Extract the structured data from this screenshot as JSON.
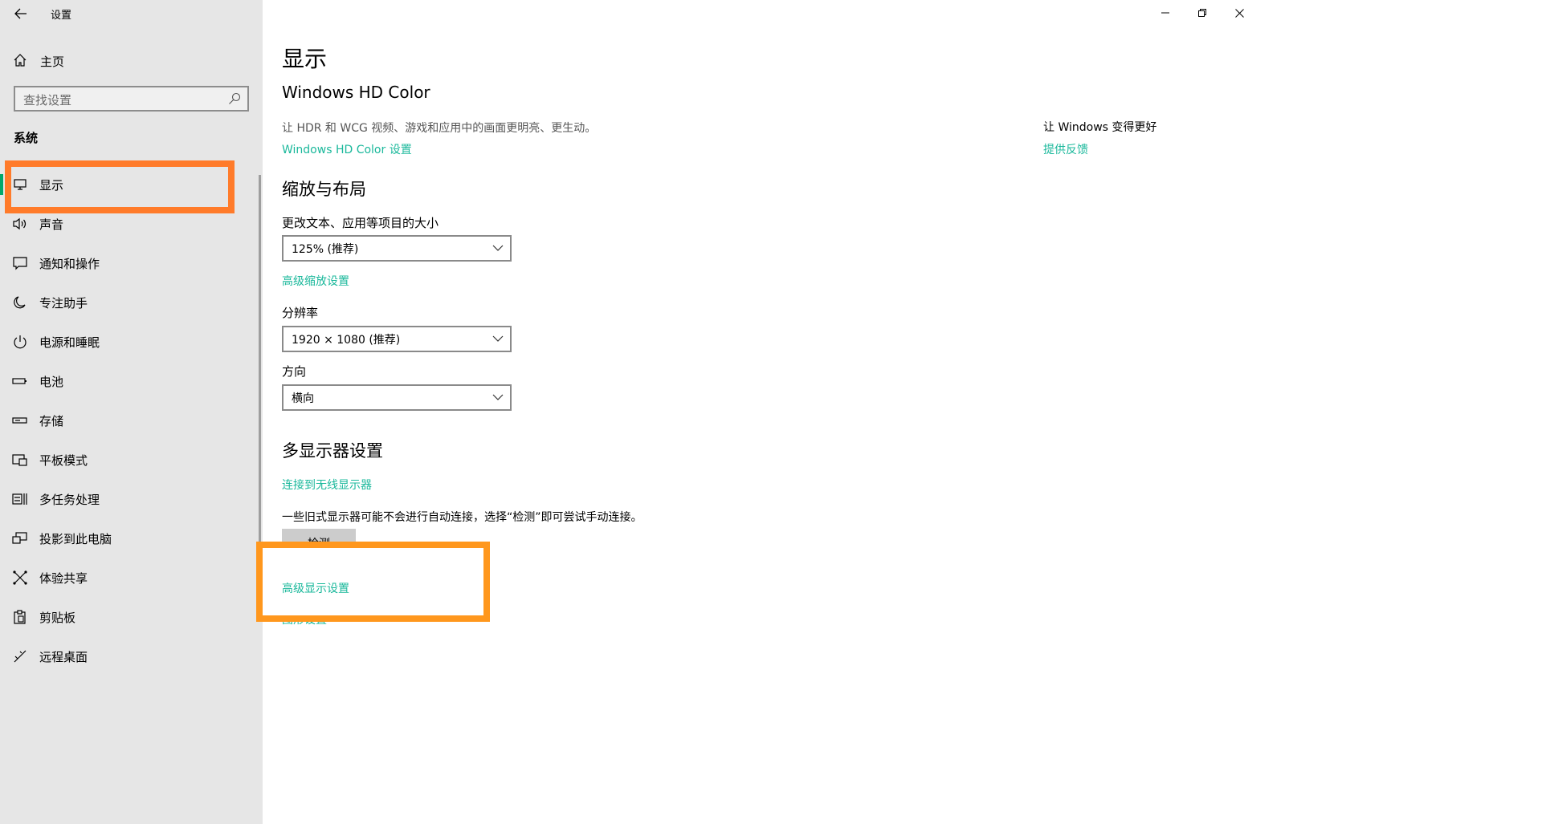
{
  "window": {
    "title": "设置",
    "controls": {
      "minimize": "minimize-icon",
      "restore": "restore-icon",
      "close": "close-icon"
    }
  },
  "sidebar": {
    "home_label": "主页",
    "search_placeholder": "查找设置",
    "section_label": "系统",
    "items": [
      {
        "label": "显示",
        "icon": "monitor-icon",
        "active": true
      },
      {
        "label": "声音",
        "icon": "speaker-icon"
      },
      {
        "label": "通知和操作",
        "icon": "notification-icon"
      },
      {
        "label": "专注助手",
        "icon": "moon-icon"
      },
      {
        "label": "电源和睡眠",
        "icon": "power-icon"
      },
      {
        "label": "电池",
        "icon": "battery-icon"
      },
      {
        "label": "存储",
        "icon": "storage-icon"
      },
      {
        "label": "平板模式",
        "icon": "tablet-mode-icon"
      },
      {
        "label": "多任务处理",
        "icon": "multitasking-icon"
      },
      {
        "label": "投影到此电脑",
        "icon": "project-icon"
      },
      {
        "label": "体验共享",
        "icon": "shared-experiences-icon"
      },
      {
        "label": "剪贴板",
        "icon": "clipboard-icon"
      },
      {
        "label": "远程桌面",
        "icon": "remote-desktop-icon"
      }
    ],
    "accent_color": "#00a86b"
  },
  "main": {
    "page_title": "显示",
    "hd_color": {
      "heading": "Windows HD Color",
      "description": "让 HDR 和 WCG 视频、游戏和应用中的画面更明亮、更生动。",
      "link": "Windows HD Color 设置"
    },
    "scale_layout": {
      "heading": "缩放与布局",
      "scale_label": "更改文本、应用等项目的大小",
      "scale_value": "125% (推荐)",
      "advanced_scale_link": "高级缩放设置",
      "resolution_label": "分辨率",
      "resolution_value": "1920 × 1080 (推荐)",
      "orientation_label": "方向",
      "orientation_value": "横向"
    },
    "multi_display": {
      "heading": "多显示器设置",
      "wireless_link": "连接到无线显示器",
      "note": "一些旧式显示器可能不会进行自动连接，选择“检测”即可尝试手动连接。",
      "detect_button": "检测",
      "advanced_display_link": "高级显示设置",
      "graphics_link": "图形设置"
    },
    "link_color": "#1ab89b"
  },
  "right_column": {
    "title": "让 Windows 变得更好",
    "feedback_link": "提供反馈"
  },
  "annotations": {
    "highlight_color_1": "#ff7b2a",
    "highlight_color_2": "#ff971d"
  }
}
